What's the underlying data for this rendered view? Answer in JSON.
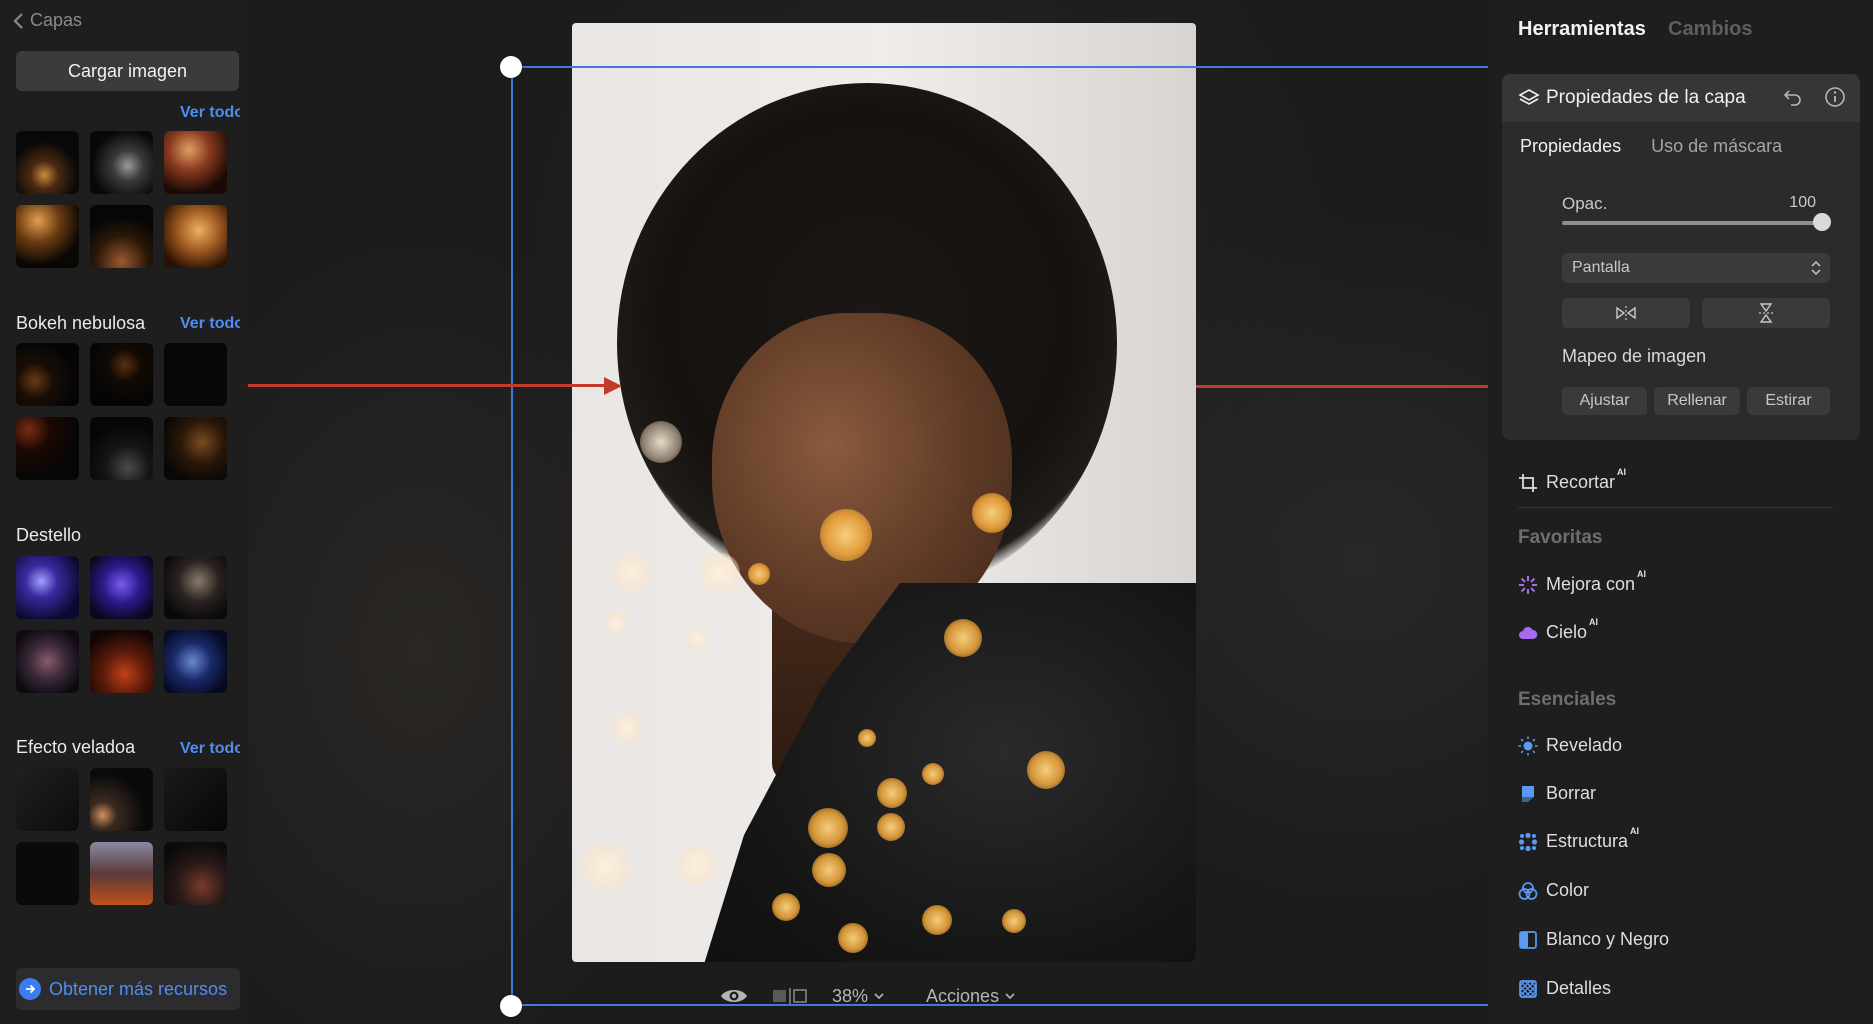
{
  "left_panel": {
    "back_label": "Capas",
    "load_button": "Cargar imagen",
    "sections": [
      {
        "title": "Bokeh nebulosa",
        "see_all": "Ver todo"
      },
      {
        "title": "Destello",
        "see_all": ""
      },
      {
        "title": "Efecto veladoa",
        "see_all": "Ver todo"
      }
    ],
    "top_see_all": "Ver todo",
    "more_resources": "Obtener más recursos"
  },
  "canvas_bar": {
    "zoom": "38%",
    "actions": "Acciones"
  },
  "right_panel": {
    "tabs": [
      "Herramientas",
      "Cambios"
    ],
    "card": {
      "title": "Propiedades de la capa",
      "subtabs": [
        "Propiedades",
        "Uso de máscara"
      ],
      "opacity_label": "Opac.",
      "opacity_value": "100",
      "opacity_fraction": 1.0,
      "blend_mode": "Pantalla",
      "mapping_title": "Mapeo de imagen",
      "mapping_buttons": [
        "Ajustar",
        "Rellenar",
        "Estirar"
      ]
    },
    "crop": "Recortar",
    "ai_badge": "AI",
    "favorites_title": "Favoritas",
    "favorites": [
      "Mejora con",
      "Cielo"
    ],
    "essentials_title": "Esenciales",
    "essentials": [
      "Revelado",
      "Borrar",
      "Estructura",
      "Color",
      "Blanco y Negro",
      "Detalles"
    ]
  },
  "colors": {
    "accent_blue": "#3f78e0",
    "link_blue": "#4f8ef0",
    "arrow_red": "#c23a2c",
    "panel_bg": "#1e1e1f",
    "card_bg": "#2b2b2d"
  }
}
